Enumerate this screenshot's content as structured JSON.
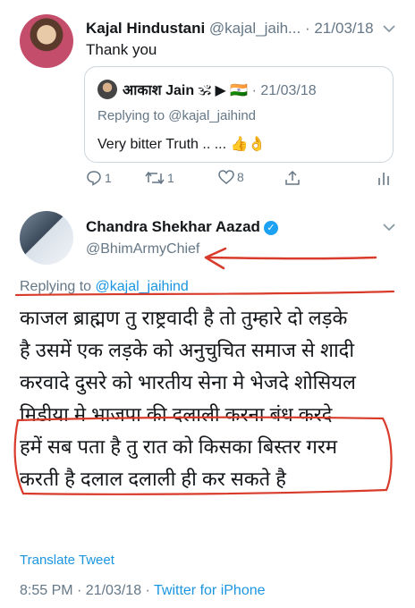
{
  "reply_tweet": {
    "author_name": "Kajal Hindustani",
    "author_handle": "@kajal_jaih...",
    "date": "· 21/03/18",
    "text": "Thank you",
    "quoted": {
      "author_name": "आकाश Jain",
      "flags": "🕉 ▶ 🇮🇳",
      "date": "· 21/03/18",
      "replying_to_prefix": "Replying to ",
      "replying_to_handle": "@kajal_jaihind",
      "text": "Very bitter Truth .. ... 👍👌"
    },
    "actions": {
      "replies": "1",
      "retweets": "1",
      "likes": "8"
    }
  },
  "main_tweet": {
    "author_name": "Chandra Shekhar Aazad",
    "verified_mark": "✓",
    "author_handle": "@BhimArmyChief",
    "replying_to_prefix": "Replying to ",
    "replying_to_handle": "@kajal_jaihind",
    "text_lines": [
      "काजल ब्राह्मण तु राष्ट्रवादी है तो तुम्हारे दो लड़के",
      "है उसमें एक लड़के को अनुचुचित समाज से शादी",
      "करवादे दुसरे को भारतीय सेना मे भेजदे शोसियल",
      "मिडीया मे भाजपा की दलाली करना बंध करदे",
      "हमें सब पता है तु रात को किसका बिस्तर गरम",
      "करती है दलाल दलाली ही कर सकते है"
    ],
    "translate_label": "Translate Tweet",
    "time": "8:55 PM · 21/03/18 · ",
    "client": "Twitter for iPhone"
  },
  "icons": {
    "chevron": "chevron-down-icon",
    "reply": "reply-icon",
    "retweet": "retweet-icon",
    "like": "heart-icon",
    "share": "share-icon",
    "analytics": "analytics-icon"
  },
  "colors": {
    "link_blue": "#1b95e0",
    "muted": "#657786",
    "annotation_red": "#d93b2b"
  }
}
